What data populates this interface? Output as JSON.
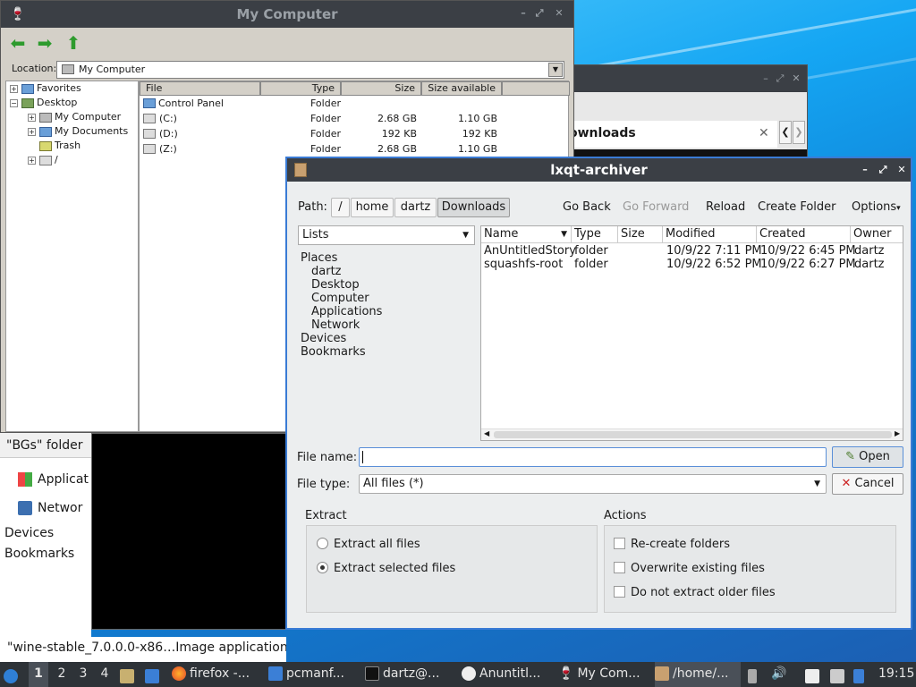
{
  "wine": {
    "title": "My Computer",
    "location_label": "Location:",
    "location_value": "My Computer",
    "tree": [
      "Favorites",
      "Desktop",
      "My Computer",
      "My Documents",
      "Trash",
      "/"
    ],
    "columns": [
      "File",
      "Type",
      "Size",
      "Size available"
    ],
    "rows": [
      {
        "name": "Control Panel",
        "type": "Folder",
        "size": "",
        "avail": ""
      },
      {
        "name": "(C:)",
        "type": "Folder",
        "size": "2.68 GB",
        "avail": "1.10 GB"
      },
      {
        "name": "(D:)",
        "type": "Folder",
        "size": "192 KB",
        "avail": "192 KB"
      },
      {
        "name": "(Z:)",
        "type": "Folder",
        "size": "2.68 GB",
        "avail": "1.10 GB"
      }
    ]
  },
  "bg_window": {
    "header": "\"BGs\" folder",
    "items": [
      "Applicat",
      "Networ",
      "Devices",
      "Bookmarks"
    ],
    "status": "\"wine-stable_7.0.0.0-x86…Image application b"
  },
  "pcmanfm": {
    "tab_title": "ownloads"
  },
  "archiver": {
    "title": "lxqt-archiver",
    "path_label": "Path:",
    "crumbs": [
      "/",
      "home",
      "dartz",
      "Downloads"
    ],
    "actions": {
      "back": "Go Back",
      "forward": "Go Forward",
      "reload": "Reload",
      "create": "Create Folder",
      "options": "Options"
    },
    "lists_label": "Lists",
    "places": [
      "Places",
      "dartz",
      "Desktop",
      "Computer",
      "Applications",
      "Network",
      "Devices",
      "Bookmarks"
    ],
    "columns": [
      "Name",
      "Type",
      "Size",
      "Modified",
      "Created",
      "Owner"
    ],
    "files": [
      {
        "name": "AnUntitledStory",
        "type": "folder",
        "size": "",
        "modified": "10/9/22 7:11 PM",
        "created": "10/9/22 6:45 PM",
        "owner": "dartz"
      },
      {
        "name": "squashfs-root",
        "type": "folder",
        "size": "",
        "modified": "10/9/22 6:52 PM",
        "created": "10/9/22 6:27 PM",
        "owner": "dartz"
      }
    ],
    "file_name_label": "File name:",
    "file_name_value": "",
    "file_type_label": "File type:",
    "file_type_value": "All files (*)",
    "open_label": "Open",
    "cancel_label": "Cancel",
    "extract_group": "Extract",
    "extract_all": "Extract all files",
    "extract_selected": "Extract selected files",
    "actions_group": "Actions",
    "recreate": "Re-create folders",
    "overwrite": "Overwrite existing files",
    "no_older": "Do not extract older files"
  },
  "taskbar": {
    "workspaces": [
      "1",
      "2",
      "3",
      "4"
    ],
    "tasks": [
      "firefox -...",
      "pcmanf...",
      "dartz@...",
      "Anuntitl...",
      "My Com...",
      "/home/..."
    ],
    "clock": "19:15"
  }
}
